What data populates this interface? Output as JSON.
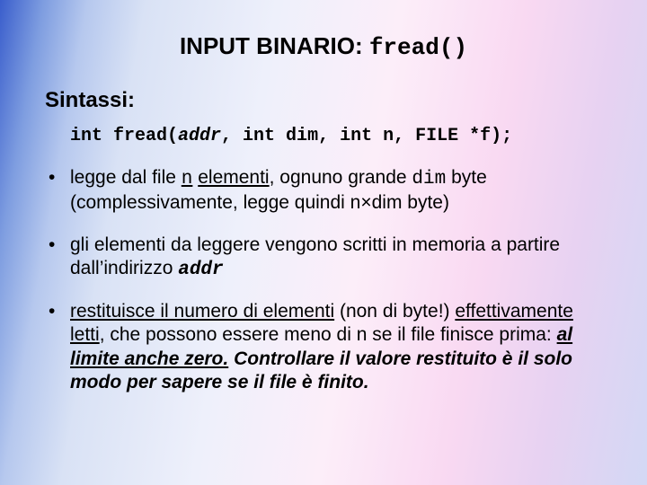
{
  "title_prefix": "INPUT BINARIO: ",
  "title_func": "fread()",
  "subheading": "Sintassi:",
  "signature": {
    "p1": "int fread(",
    "addr": "addr",
    "p2": ", int dim, int n, FILE *f);"
  },
  "bullets": {
    "b1": {
      "t1": "legge dal file ",
      "n": "n",
      "sp1": " ",
      "elementi": "elementi",
      "t2": ", ognuno grande ",
      "dim": "dim",
      "t3": " byte (complessivamente, legge quindi n",
      "times": "×",
      "t4": "dim byte)"
    },
    "b2": {
      "t1": "gli elementi da leggere vengono scritti in memoria a partire dall’indirizzo ",
      "addr": "addr"
    },
    "b3": {
      "u1": "restituisce il numero di elementi",
      "t1": " (non di byte!) ",
      "u2": "effet­tivamente letti",
      "t2": ", che possono essere meno di n se il file finisce prima: ",
      "em1": "al limite anche zero.",
      "sp": " ",
      "em2": "Controllare il valore restituito è il solo modo per sapere se il file è finito."
    }
  }
}
